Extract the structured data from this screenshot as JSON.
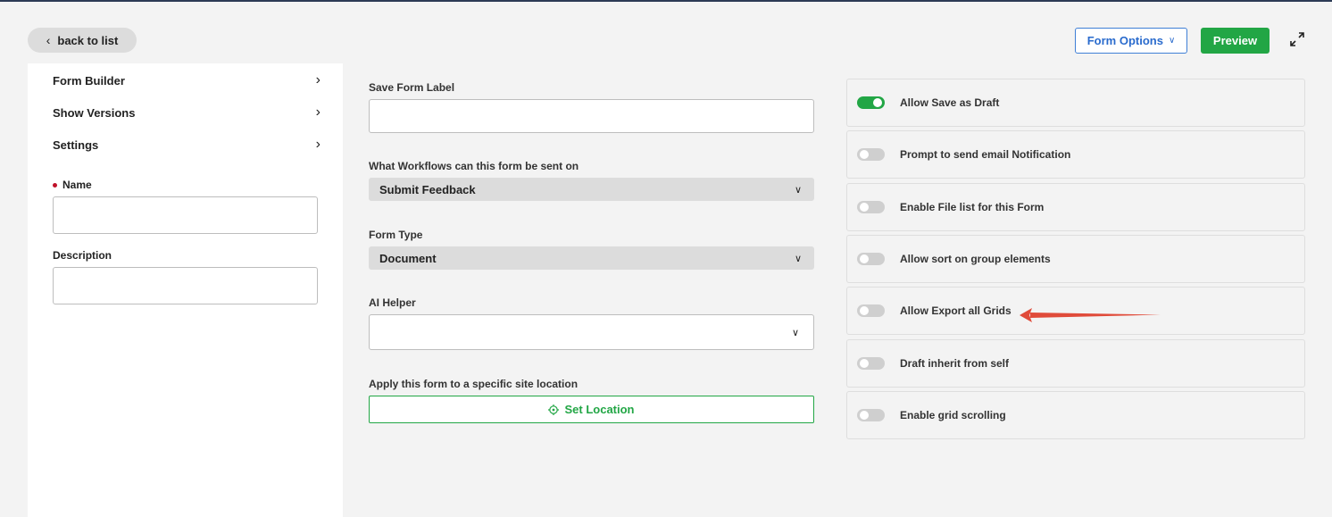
{
  "header": {
    "back_label": "back to list",
    "form_options_label": "Form Options",
    "preview_label": "Preview"
  },
  "sidebar": {
    "items": [
      {
        "label": "Form Builder"
      },
      {
        "label": "Show Versions"
      },
      {
        "label": "Settings"
      }
    ],
    "name_label": "Name",
    "name_value": "",
    "description_label": "Description",
    "description_value": ""
  },
  "main": {
    "save_form_label": "Save Form Label",
    "save_form_value": "",
    "workflows_label": "What Workflows can this form be sent on",
    "workflows_value": "Submit Feedback",
    "form_type_label": "Form Type",
    "form_type_value": "Document",
    "ai_helper_label": "AI Helper",
    "ai_helper_value": "",
    "location_label": "Apply this form to a specific site location",
    "set_location_label": "Set Location"
  },
  "options": [
    {
      "label": "Allow Save as Draft",
      "enabled": true
    },
    {
      "label": "Prompt to send email Notification",
      "enabled": false
    },
    {
      "label": "Enable File list for this Form",
      "enabled": false
    },
    {
      "label": "Allow sort on group elements",
      "enabled": false
    },
    {
      "label": "Allow Export all Grids",
      "enabled": false
    },
    {
      "label": "Draft inherit from self",
      "enabled": false
    },
    {
      "label": "Enable grid scrolling",
      "enabled": false
    }
  ],
  "colors": {
    "accent_green": "#22a645",
    "accent_blue": "#2a6bcd",
    "annotation_red": "#e04b3a"
  },
  "icons": [
    "chevron-left-icon",
    "chevron-down-icon",
    "expand-icon",
    "chevron-right-icon",
    "crosshair-icon"
  ]
}
